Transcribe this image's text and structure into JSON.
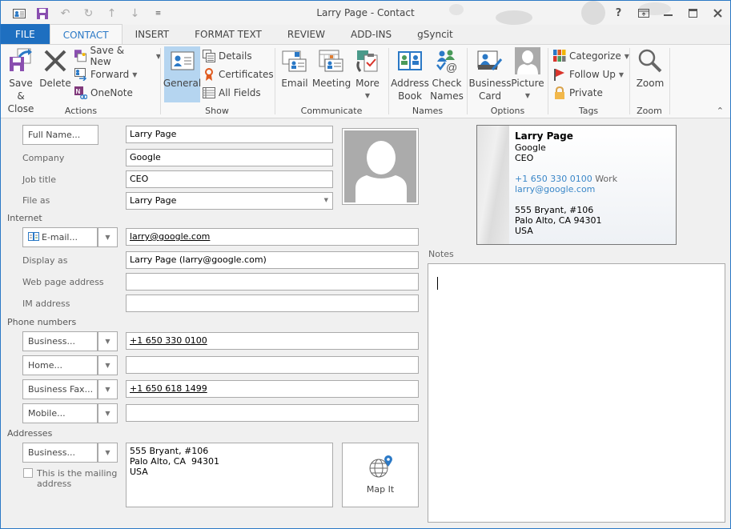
{
  "window": {
    "title": "Larry Page - Contact",
    "controls": {
      "help": "?",
      "restore_ribbon": "ribbon-display-options",
      "minimize": "minimize",
      "maximize": "maximize",
      "close": "close"
    }
  },
  "qat": {
    "items": [
      "contact-icon",
      "save-icon",
      "undo-icon",
      "redo-icon",
      "previous-item-icon",
      "next-item-icon",
      "customize-qat-icon"
    ]
  },
  "tabs": [
    {
      "label": "FILE"
    },
    {
      "label": "CONTACT",
      "active": true
    },
    {
      "label": "INSERT"
    },
    {
      "label": "FORMAT TEXT"
    },
    {
      "label": "REVIEW"
    },
    {
      "label": "ADD-INS"
    },
    {
      "label": "gSyncit"
    }
  ],
  "ribbon": {
    "actions": {
      "label": "Actions",
      "save_close": "Save &",
      "save_close_2": "Close",
      "delete": "Delete",
      "save_new": "Save & New",
      "forward": "Forward",
      "onenote": "OneNote"
    },
    "show": {
      "label": "Show",
      "general": "General",
      "details": "Details",
      "certificates": "Certificates",
      "all_fields": "All Fields"
    },
    "communicate": {
      "label": "Communicate",
      "email": "Email",
      "meeting": "Meeting",
      "more": "More"
    },
    "names": {
      "label": "Names",
      "address_book_1": "Address",
      "address_book_2": "Book",
      "check_names_1": "Check",
      "check_names_2": "Names"
    },
    "options": {
      "label": "Options",
      "business_card_1": "Business",
      "business_card_2": "Card",
      "picture": "Picture"
    },
    "tags": {
      "label": "Tags",
      "categorize": "Categorize",
      "follow_up": "Follow Up",
      "private": "Private"
    },
    "zoom": {
      "label": "Zoom",
      "zoom": "Zoom"
    }
  },
  "form": {
    "full_name_button": "Full Name...",
    "full_name": "Larry Page",
    "company_label": "Company",
    "company": "Google",
    "job_title_label": "Job title",
    "job_title": "CEO",
    "file_as_label": "File as",
    "file_as": "Larry Page",
    "internet_section": "Internet",
    "email_button": "E-mail...",
    "email": "larry@google.com",
    "display_as_label": "Display as",
    "display_as": "Larry Page (larry@google.com)",
    "web_page_label": "Web page address",
    "web_page": "",
    "im_label": "IM address",
    "im": "",
    "phone_section": "Phone numbers",
    "phones": [
      {
        "type": "Business...",
        "value": "+1 650 330 0100"
      },
      {
        "type": "Home...",
        "value": ""
      },
      {
        "type": "Business Fax...",
        "value": "+1 650 618 1499"
      },
      {
        "type": "Mobile...",
        "value": ""
      }
    ],
    "addresses_section": "Addresses",
    "address_type": "Business...",
    "address": "555 Bryant, #106\nPalo Alto, CA  94301\nUSA",
    "mailing_checkbox_1": "This is the mailing",
    "mailing_checkbox_2": "address",
    "mailing_checked": false,
    "map_it": "Map It",
    "notes_label": "Notes",
    "notes": ""
  },
  "business_card": {
    "name": "Larry Page",
    "company": "Google",
    "title": "CEO",
    "phone": "+1 650 330 0100",
    "phone_type": "Work",
    "email": "larry@google.com",
    "address_1": "555 Bryant, #106",
    "address_2": "Palo Alto, CA  94301",
    "address_3": "USA"
  },
  "colors": {
    "accent": "#2b79c6",
    "file_tab": "#1e6fc0",
    "selected_button": "#b5d5f0",
    "link": "#3a87c8"
  }
}
